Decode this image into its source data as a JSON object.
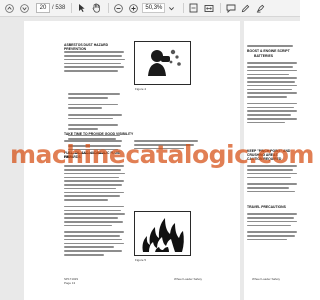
{
  "toolbar": {
    "page_current": "20",
    "page_total": "/ 538",
    "zoom": "50,3%"
  },
  "page": {
    "left_heading": "ASBESTOS DUST HAZARD PREVENTION",
    "mid_heading": "TAKE TIME TO PROVIDE GOOD VISIBILITY",
    "fuel_heading_1": "FUEL, OIL AND HYDRAULIC FLUID FIRE",
    "fuel_heading_2": "HAZARDS",
    "figure_a": "Figure 4",
    "figure_b": "Figure 5",
    "footer_left_1": "SP171029",
    "footer_left_2": "Page 13",
    "footer_right": "Wheel Loader Safety"
  },
  "page2": {
    "heading_1": "BOOST & ENGINE SCRIPT",
    "heading_2": "BATTERIES",
    "heading_3": "KEEP \"PINCH POINT\" AND CRUSHING AREAS",
    "heading_4": "CAUTION REQUIRED",
    "heading_5": "TRAVEL PRECAUTIONS",
    "footer": "Wheel Loader Safety"
  },
  "watermark": "machinecatalogic.com"
}
